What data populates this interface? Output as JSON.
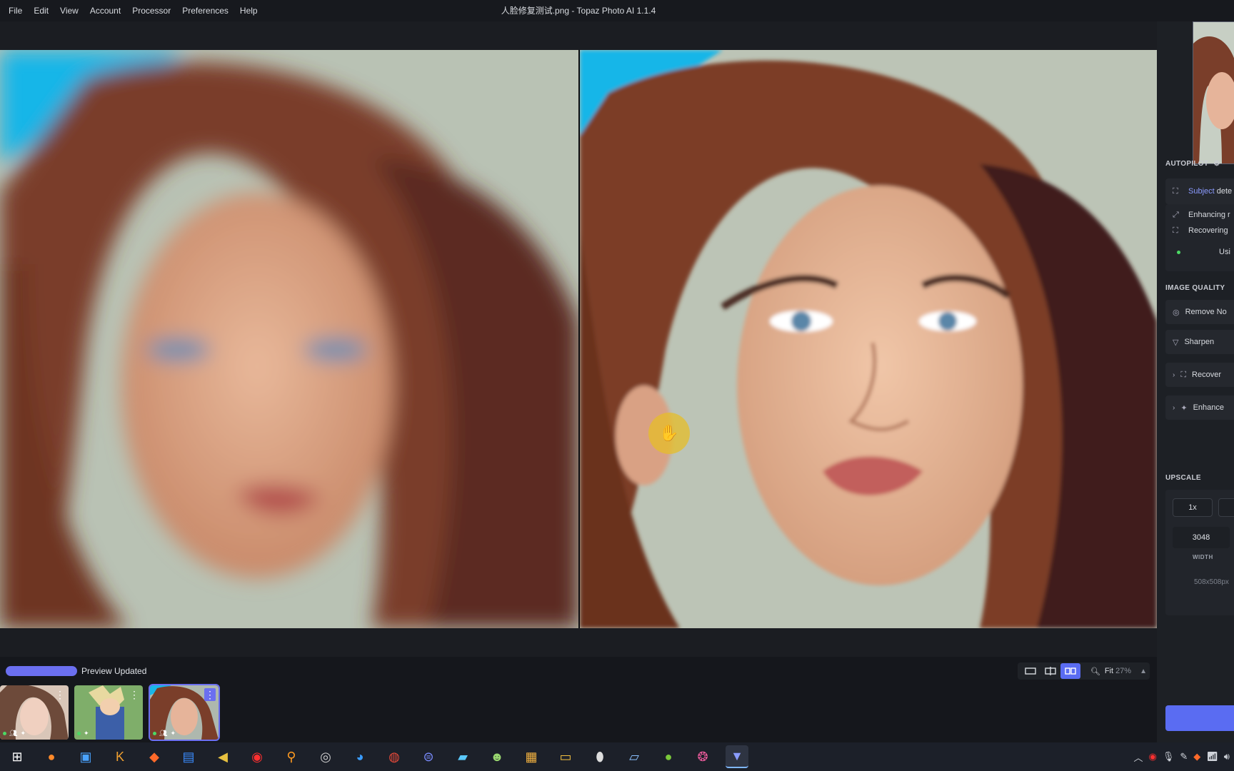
{
  "menu": {
    "items": [
      "File",
      "Edit",
      "View",
      "Account",
      "Processor",
      "Preferences",
      "Help"
    ],
    "title": "人脸修复测试.png - Topaz Photo AI 1.1.4"
  },
  "status": {
    "text": "Preview Updated",
    "progress": 1.0,
    "zoom_label": "Fit",
    "zoom_pct": "27%"
  },
  "filmstrip": {
    "thumbnails": [
      {
        "name": "portrait-asian-girl",
        "selected": false
      },
      {
        "name": "anime-character",
        "selected": false
      },
      {
        "name": "woman-portrait",
        "selected": true
      }
    ]
  },
  "panel": {
    "autopilot_title": "AUTOPILOT",
    "subject_prefix": "Subject",
    "subject_rest": "dete",
    "enhancing": "Enhancing r",
    "recovering": "Recovering",
    "using": "Usi",
    "image_quality_title": "IMAGE QUALITY",
    "remove_noise": "Remove No",
    "sharpen": "Sharpen",
    "recover_faces": "Recover",
    "enhance": "Enhance",
    "upscale_title": "UPSCALE",
    "scale_1x": "1x",
    "width_value": "3048",
    "width_label": "WIDTH",
    "dims": "508x508px"
  },
  "colors": {
    "accent": "#5a6cf2",
    "progress": "#6b6ff0",
    "cursor_ring": "#e6be28"
  },
  "taskbar": {
    "icons": [
      "windows-start-icon",
      "firefox-icon",
      "network-tool-icon",
      "k-app-icon",
      "paper-plane-icon",
      "printer-icon",
      "arrow-app-icon",
      "record-icon",
      "search-app-icon",
      "obs-icon",
      "translate-icon",
      "chrome-icon",
      "lock-app-icon",
      "bird-app-icon",
      "panda-app-icon",
      "package-icon",
      "folder-icon",
      "mouse-app-icon",
      "notes-app-icon",
      "ball-app-icon",
      "color-wheel-icon",
      "topaz-icon"
    ]
  }
}
